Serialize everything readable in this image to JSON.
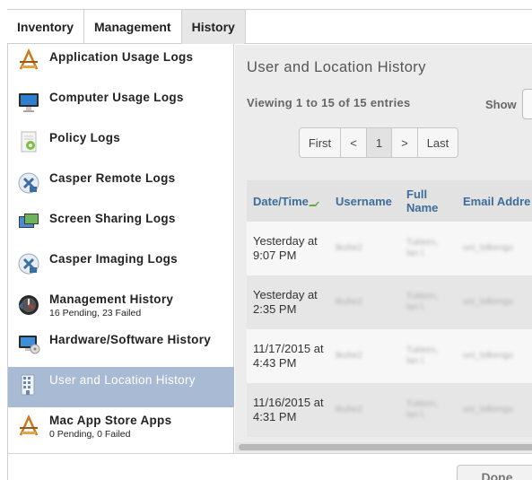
{
  "tabs": [
    {
      "label": "Inventory"
    },
    {
      "label": "Management"
    },
    {
      "label": "History"
    }
  ],
  "sidebar": {
    "items": [
      {
        "label": "Application Usage Logs",
        "icon": "app-usage-icon"
      },
      {
        "label": "Computer Usage Logs",
        "icon": "monitor-icon"
      },
      {
        "label": "Policy Logs",
        "icon": "policy-icon"
      },
      {
        "label": "Casper Remote Logs",
        "icon": "casper-remote-icon"
      },
      {
        "label": "Screen Sharing Logs",
        "icon": "screen-sharing-icon"
      },
      {
        "label": "Casper Imaging Logs",
        "icon": "casper-imaging-icon"
      },
      {
        "label": "Management History",
        "sub": "16 Pending, 23 Failed",
        "icon": "management-history-icon"
      },
      {
        "label": "Hardware/Software History",
        "icon": "hardware-software-icon"
      },
      {
        "label": "User and Location History",
        "icon": "building-icon",
        "selected": true
      },
      {
        "label": "Mac App Store Apps",
        "sub": "0 Pending, 0 Failed",
        "icon": "app-store-icon"
      }
    ]
  },
  "main": {
    "title": "User and Location History",
    "viewing": "Viewing 1 to 15 of 15 entries",
    "show_label": "Show",
    "pager": {
      "first": "First",
      "prev": "<",
      "page": "1",
      "next": ">",
      "last": "Last"
    },
    "table": {
      "headers": [
        "Date/Time",
        "Username",
        "Full Name",
        "Email Addre"
      ],
      "rows": [
        {
          "date": "Yesterday at 9:07 PM",
          "username": "tkuhe2",
          "fullname": "Tukken, lan l.",
          "email": "uni_lolkengu"
        },
        {
          "date": "Yesterday at 2:35 PM",
          "username": "tkuhe2",
          "fullname": "Tukken, lan l.",
          "email": "uni_lolkengu"
        },
        {
          "date": "11/17/2015 at 4:43 PM",
          "username": "tkuhe2",
          "fullname": "Tukken, lan l.",
          "email": "uni_lolkengu"
        },
        {
          "date": "11/16/2015 at 4:31 PM",
          "username": "tkuhe2",
          "fullname": "Tukken, lan l.",
          "email": "uni_lolkengu"
        }
      ]
    }
  },
  "footer": {
    "done": "Done"
  },
  "colors": {
    "accent": "#3d6d9a",
    "selected": "#a9bbd4",
    "sort": "#6aa84f"
  }
}
